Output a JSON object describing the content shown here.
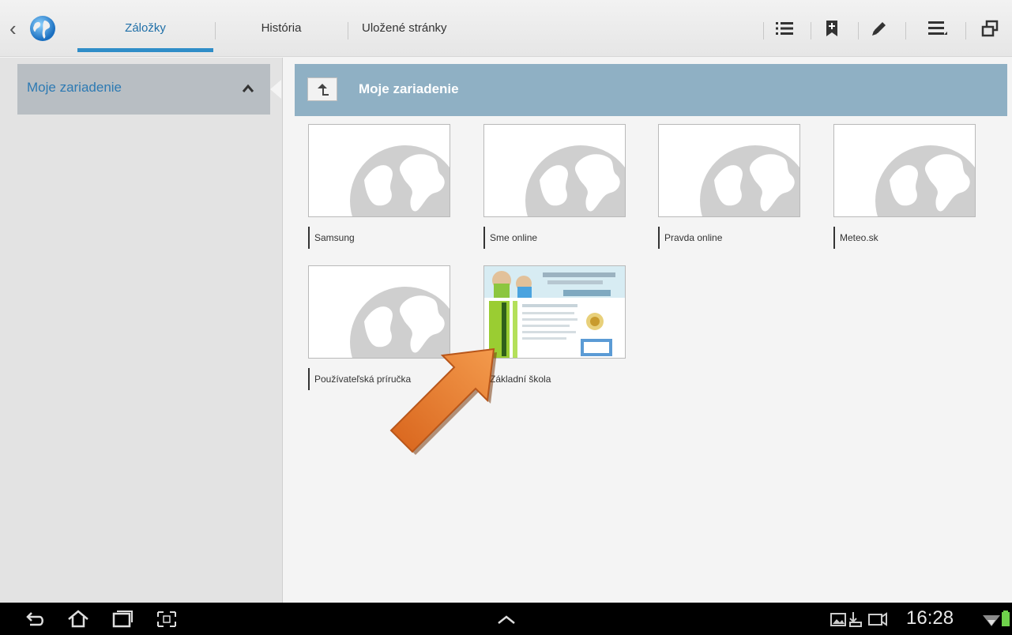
{
  "tabs": {
    "bookmarks": "Záložky",
    "history": "História",
    "saved_pages": "Uložené stránky"
  },
  "toolbar_icons": [
    "list-view-icon",
    "add-bookmark-icon",
    "edit-icon",
    "menu-icon",
    "window-icon"
  ],
  "sidebar": {
    "item_label": "Moje zariadenie"
  },
  "folder": {
    "title": "Moje zariadenie"
  },
  "bookmarks": [
    {
      "label": "Samsung",
      "thumb": "globe"
    },
    {
      "label": "Sme online",
      "thumb": "globe"
    },
    {
      "label": "Pravda online",
      "thumb": "globe"
    },
    {
      "label": "Meteo.sk",
      "thumb": "globe"
    },
    {
      "label": "Používateľská príručka",
      "thumb": "globe"
    },
    {
      "label": "Základní škola",
      "thumb": "website"
    }
  ],
  "statusbar": {
    "time": "16:28"
  },
  "colors": {
    "accent": "#2f8dc8",
    "header": "#8fb0c4",
    "arrow": "#ec7a2b"
  }
}
